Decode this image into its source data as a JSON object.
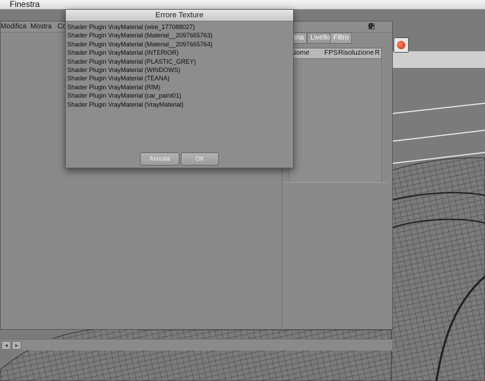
{
  "menubar": {
    "title": "Finestra"
  },
  "panel": {
    "menu": [
      "Modifica",
      "Mostra",
      "Co"
    ],
    "tabs": [
      "toria",
      "Livello",
      "Filtro"
    ],
    "columns": [
      "Nome",
      "FPS",
      "Risoluzione",
      "R"
    ]
  },
  "dialog": {
    "title": "Errore Texture",
    "messages": [
      "Shader Plugin VrayMaterial (wire_177088027)",
      "Shader Plugin VrayMaterial (Material__2097665763)",
      "Shader Plugin VrayMaterial (Material__2097665764)",
      "Shader Plugin VrayMaterial (INTERIOR)",
      "Shader Plugin VrayMaterial (PLASTIC_GREY)",
      "Shader Plugin VrayMaterial (WINDOWS)",
      "Shader Plugin VrayMaterial (TEANA)",
      "Shader Plugin VrayMaterial (RIM)",
      "Shader Plugin VrayMaterial (car_paint01)",
      "Shader Plugin VrayMaterial (VrayMaterial)"
    ],
    "cancel_label": "Annulla",
    "ok_label": "OK"
  },
  "icons": {
    "toolbar": [
      "layout-icon",
      "move-icon",
      "arrow-down-icon"
    ],
    "render": "render-globe-icon"
  },
  "colors": {
    "accent_render": "#c0281a",
    "dialog_bg": "#8d8d8d"
  }
}
